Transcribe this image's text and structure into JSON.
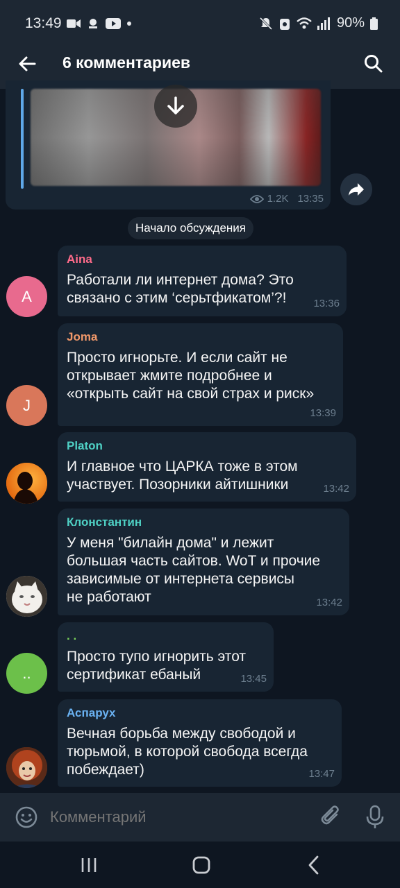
{
  "status": {
    "time": "13:49",
    "battery": "90%"
  },
  "header": {
    "title": "6 комментариев"
  },
  "post": {
    "views": "1.2K",
    "time": "13:35"
  },
  "discussion_start": "Начало обсуждения",
  "colors": {
    "accent_blue": "#5fa8e8",
    "bubble": "#182533",
    "background": "#0e1621",
    "bar": "#1d2733"
  },
  "comments": [
    {
      "author": "Aina",
      "initial": "A",
      "text": "Работали ли интернет дома? Это\nсвязано с этим ‘серьтфикатом’?!",
      "time": "13:36",
      "name_color": "#ff6b8a",
      "avatar_color": "#e86a8e"
    },
    {
      "author": "Joma",
      "initial": "J",
      "text": "Просто игнорьте. И если сайт не\nоткрывает жмите подробнее и\n«открыть сайт на свой страх и риск»",
      "time": "13:39",
      "name_color": "#f0986a",
      "avatar_color": "#d9775a"
    },
    {
      "author": "Platon",
      "initial": "",
      "text": "И главное что ЦАРКА тоже в этом\nучаствует. Позорники айтишники",
      "time": "13:42",
      "name_color": "#4fd1c5",
      "avatar_icon": "silhouette-avatar"
    },
    {
      "author": "Клонстантин",
      "initial": "",
      "text": "У меня \"билайн дома\" и лежит\nбольшая часть сайтов. WoT и прочие\nзависимые от интернета  сервисы\nне работают",
      "time": "13:42",
      "name_color": "#4fd1c5",
      "avatar_icon": "cat-avatar"
    },
    {
      "author": ". .",
      "initial": "..",
      "text": "Просто тупо игнорить этот\nсертификат ебаный",
      "time": "13:45",
      "name_color": "#7bd35a",
      "avatar_color": "#6cc04a"
    },
    {
      "author": "Аспарух",
      "initial": "",
      "text": "Вечная борьба между свободой и\nтюрьмой, в которой свобода всегда\nпобеждает)",
      "time": "13:47",
      "name_color": "#6ab2f2",
      "avatar_icon": "doll-avatar"
    }
  ],
  "composer": {
    "placeholder": "Комментарий"
  }
}
